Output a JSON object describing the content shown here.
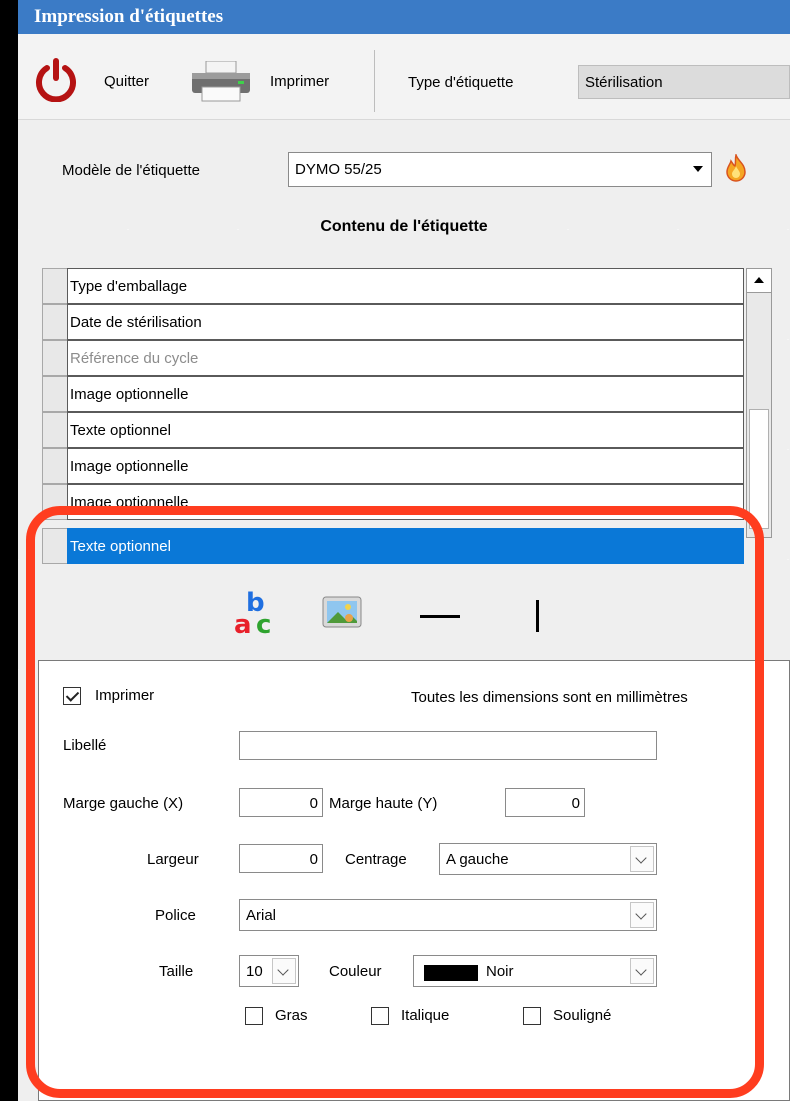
{
  "window": {
    "title": "Impression d'étiquettes"
  },
  "toolbar": {
    "quit_label": "Quitter",
    "print_label": "Imprimer",
    "label_type_label": "Type d'étiquette",
    "label_type_value": "Stérilisation"
  },
  "model": {
    "label": "Modèle de l'étiquette",
    "value": "DYMO 55/25"
  },
  "content": {
    "title": "Contenu de l'étiquette",
    "rows": [
      {
        "label": "Type d'emballage"
      },
      {
        "label": "Date de stérilisation"
      },
      {
        "label": "Référence du cycle"
      },
      {
        "label": "Image optionnelle"
      },
      {
        "label": "Texte optionnel"
      },
      {
        "label": "Image optionnelle"
      },
      {
        "label": "Image optionnelle"
      },
      {
        "label": "Texte optionnel"
      }
    ]
  },
  "tools": {
    "text": "text-tool-icon",
    "image": "image-tool-icon",
    "hline": "horizontal-line-tool-icon",
    "vline": "vertical-line-tool-icon"
  },
  "properties": {
    "print_label": "Imprimer",
    "print_checked": true,
    "units_note": "Toutes les dimensions sont en millimètres",
    "libelle_label": "Libellé",
    "libelle_value": "",
    "margin_left_label": "Marge gauche (X)",
    "margin_left_value": "0",
    "margin_top_label": "Marge haute (Y)",
    "margin_top_value": "0",
    "width_label": "Largeur",
    "width_value": "0",
    "align_label": "Centrage",
    "align_value": "A gauche",
    "font_label": "Police",
    "font_value": "Arial",
    "size_label": "Taille",
    "size_value": "10",
    "color_label": "Couleur",
    "color_value": "Noir",
    "color_hex": "#000000",
    "bold_label": "Gras",
    "italic_label": "Italique",
    "underline_label": "Souligné"
  },
  "colors": {
    "title_bar": "#3b7bc6",
    "selection": "#0a78d7",
    "highlight": "#ff3d1f"
  }
}
